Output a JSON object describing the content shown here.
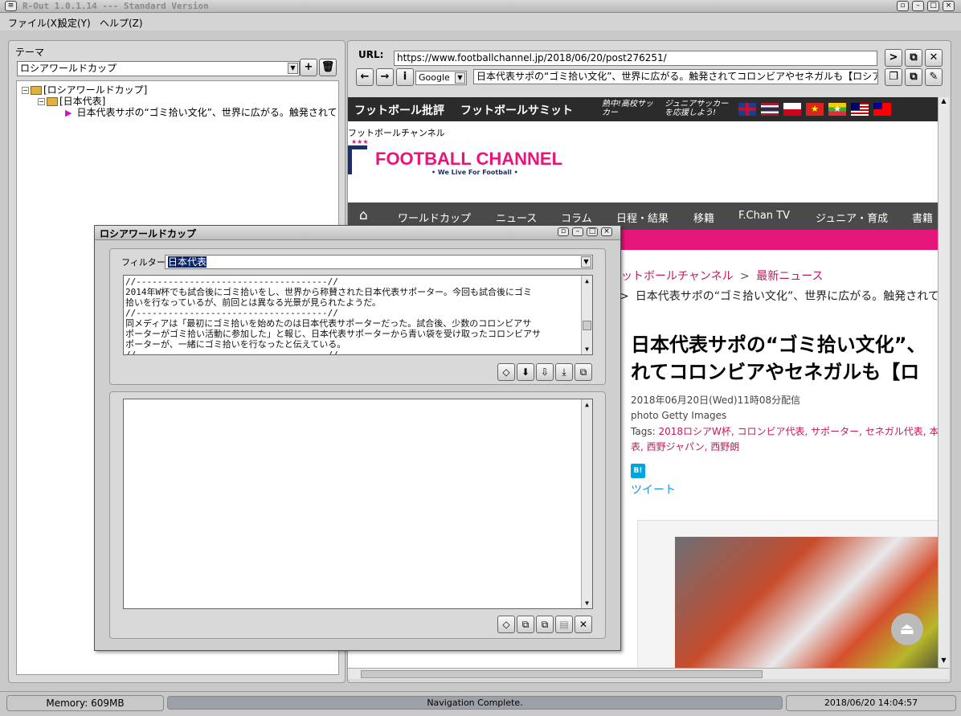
{
  "window": {
    "title": "R-Out 1.0.1.14 --- Standard Version"
  },
  "menu": [
    "ファイル(X)",
    "設定(Y)",
    "ヘルプ(Z)"
  ],
  "left": {
    "theme_label": "テーマ",
    "theme_value": "ロシアワールドカップ",
    "tree": [
      "[ロシアワールドカップ]",
      "[日本代表]",
      "日本代表サポの“ゴミ拾い文化”、世界に広がる。触発されてコロンビアやセネガルも【ロシアW杯】"
    ]
  },
  "browser": {
    "url_label": "URL:",
    "url": "https://www.footballchannel.jp/2018/06/20/post276251/",
    "engine": "Google",
    "page_title": "日本代表サポの“ゴミ拾い文化”、世界に広がる。触発されてコロンビアやセネガルも【ロシアW杯】|フットボールチャンネル"
  },
  "site": {
    "top_links": [
      "フットボール批評",
      "フットボールサミット",
      "熱中!高校サッカー",
      "ジュニアサッカーを応援しよう!"
    ],
    "brand_small": "フットボールチャンネル",
    "logo_text": "FOOTBALL CHANNEL",
    "logo_tagline": "• We Live For Football •",
    "logo_stars": "★★★",
    "nav": [
      "ワールドカップ",
      "ニュース",
      "コラム",
      "日程・結果",
      "移籍",
      "F.Chan TV",
      "ジュニア・育成",
      "書籍"
    ],
    "breadcrumb1": "ットボールチャンネル",
    "breadcrumb_sep": ">",
    "breadcrumb2": "最新ニュース",
    "breadcrumb3": "日本代表サポの“ゴミ拾い文化”、世界に広がる。触発されて",
    "headline1": "日本代表サポの“ゴミ拾い文化”、",
    "headline2": "れてコロンビアやセネガルも【ロ",
    "date": "2018年06月20日(Wed)11時08分配信",
    "photo": "photo Getty Images",
    "tags_label": "Tags:",
    "tags1": "2018ロシアW杯, コロンビア代表, サポーター, セネガル代表, 本",
    "tags2": "表, 西野ジャパン, 西野朗",
    "hatena": "B!",
    "tweet": "ツイート",
    "flag_colors": [
      "#c8102e",
      "#1d3c8f",
      "#d0021b",
      "#da251d",
      "#fecb00",
      "#cc0000",
      "#fe0000"
    ]
  },
  "dialog": {
    "title": "ロシアワールドカップ",
    "filter_label": "フィルター:",
    "filter_value": "日本代表",
    "text_lines": [
      "//------------------------------------//",
      "  2014年W杯でも試合後にゴミ拾いをし、世界から称賛された日本代表サポーター。今回も試合後にゴミ",
      "拾いを行なっているが、前回とは異なる光景が見られたようだ。",
      "//------------------------------------//",
      "  同メディアは「最初にゴミ拾いを始めたのは日本代表サポーターだった。試合後、少数のコロンビアサ",
      "ポーターがゴミ拾い活動に参加した」と報じ、日本代表サポーターから青い袋を受け取ったコロンビアサ",
      "ポーターが、一緒にゴミ拾いを行なったと伝えている。",
      "//------------------------------------//"
    ]
  },
  "status": {
    "memory": "Memory: 609MB",
    "nav": "Navigation Complete.",
    "datetime": "2018/06/20 14:04:57"
  }
}
